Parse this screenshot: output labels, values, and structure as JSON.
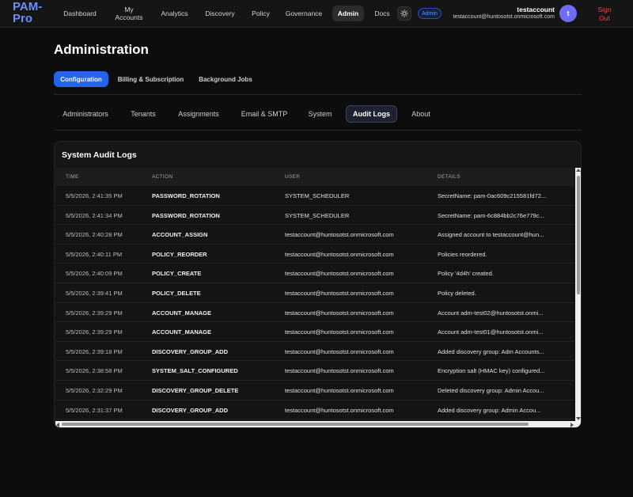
{
  "app": {
    "logo": "PAM-Pro"
  },
  "nav": [
    {
      "label": "Dashboard",
      "active": false
    },
    {
      "label": "My Accounts",
      "active": false
    },
    {
      "label": "Analytics",
      "active": false
    },
    {
      "label": "Discovery",
      "active": false
    },
    {
      "label": "Policy",
      "active": false
    },
    {
      "label": "Governance",
      "active": false
    },
    {
      "label": "Admin",
      "active": true
    },
    {
      "label": "Docs",
      "active": false
    }
  ],
  "header": {
    "theme_icon": "sun-icon",
    "role_badge": "Admin",
    "user_name": "testaccount",
    "user_email": "testaccount@huntosotst.onmicrosoft.com",
    "avatar_initial": "t",
    "sign_out": "Sign Out"
  },
  "page": {
    "title": "Administration",
    "pills": [
      {
        "label": "Configuration",
        "active": true
      },
      {
        "label": "Billing & Subscription",
        "active": false
      },
      {
        "label": "Background Jobs",
        "active": false
      }
    ],
    "subtabs": [
      {
        "label": "Administrators",
        "active": false
      },
      {
        "label": "Tenants",
        "active": false
      },
      {
        "label": "Assignments",
        "active": false
      },
      {
        "label": "Email & SMTP",
        "active": false
      },
      {
        "label": "System",
        "active": false
      },
      {
        "label": "Audit Logs",
        "active": true
      },
      {
        "label": "About",
        "active": false
      }
    ]
  },
  "audit": {
    "title": "System Audit Logs",
    "columns": {
      "time": "TIME",
      "action": "ACTION",
      "user": "USER",
      "details": "DETAILS"
    },
    "rows": [
      {
        "time": "5/5/2026, 2:41:35 PM",
        "action": "PASSWORD_ROTATION",
        "user": "SYSTEM_SCHEDULER",
        "details": "SecretName: pam-0ac609c215581fd72..."
      },
      {
        "time": "5/5/2026, 2:41:34 PM",
        "action": "PASSWORD_ROTATION",
        "user": "SYSTEM_SCHEDULER",
        "details": "SecretName: pam-6c884bb2c76e779c..."
      },
      {
        "time": "5/5/2026, 2:40:28 PM",
        "action": "ACCOUNT_ASSIGN",
        "user": "testaccount@huntosotst.onmicrosoft.com",
        "details": "Assigned account to testaccount@hun..."
      },
      {
        "time": "5/5/2026, 2:40:11 PM",
        "action": "POLICY_REORDER",
        "user": "testaccount@huntosotst.onmicrosoft.com",
        "details": "Policies reordered."
      },
      {
        "time": "5/5/2026, 2:40:09 PM",
        "action": "POLICY_CREATE",
        "user": "testaccount@huntosotst.onmicrosoft.com",
        "details": "Policy '4d4h' created."
      },
      {
        "time": "5/5/2026, 2:39:41 PM",
        "action": "POLICY_DELETE",
        "user": "testaccount@huntosotst.onmicrosoft.com",
        "details": "Policy deleted."
      },
      {
        "time": "5/5/2026, 2:39:29 PM",
        "action": "ACCOUNT_MANAGE",
        "user": "testaccount@huntosotst.onmicrosoft.com",
        "details": "Account adm-test02@huntosotst.onmi..."
      },
      {
        "time": "5/5/2026, 2:39:29 PM",
        "action": "ACCOUNT_MANAGE",
        "user": "testaccount@huntosotst.onmicrosoft.com",
        "details": "Account adm-test01@huntosotst.onmi..."
      },
      {
        "time": "5/5/2026, 2:39:18 PM",
        "action": "DISCOVERY_GROUP_ADD",
        "user": "testaccount@huntosotst.onmicrosoft.com",
        "details": "Added discovery group: Adm Accounts..."
      },
      {
        "time": "5/5/2026, 2:38:58 PM",
        "action": "SYSTEM_SALT_CONFIGURED",
        "user": "testaccount@huntosotst.onmicrosoft.com",
        "details": "Encryption salt (HMAC key) configured..."
      },
      {
        "time": "5/5/2026, 2:32:29 PM",
        "action": "DISCOVERY_GROUP_DELETE",
        "user": "testaccount@huntosotst.onmicrosoft.com",
        "details": "Deleted discovery group: Admin Accou..."
      },
      {
        "time": "5/5/2026, 2:31:37 PM",
        "action": "DISCOVERY_GROUP_ADD",
        "user": "testaccount@huntosotst.onmicrosoft.com",
        "details": "Added discovery group: Admin Accou..."
      }
    ]
  },
  "colors": {
    "accent": "#2563eb",
    "danger": "#ef4444",
    "logo": "#6b8cff",
    "avatar": "#6d6df2"
  }
}
